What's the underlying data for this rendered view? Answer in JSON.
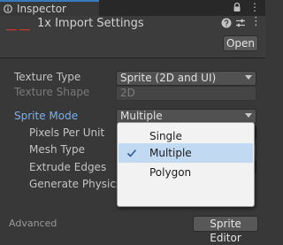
{
  "tab": {
    "title": "Inspector",
    "icon": "info-icon",
    "lock_icon": "lock-icon",
    "menu_icon": "vertical-dots-icon"
  },
  "header": {
    "title": "1x Import Settings",
    "asset_icon": "texture-asset-icon",
    "help_icon": "help-icon",
    "preset_icon": "sliders-icon",
    "more_icon": "vertical-dots-icon",
    "open_button": "Open"
  },
  "properties": {
    "texture_type": {
      "label": "Texture Type",
      "value": "Sprite (2D and UI)"
    },
    "texture_shape": {
      "label": "Texture Shape",
      "value": "2D"
    },
    "sprite_mode": {
      "label": "Sprite Mode",
      "value": "Multiple"
    },
    "pixels_per_unit": {
      "label": "Pixels Per Unit"
    },
    "mesh_type": {
      "label": "Mesh Type"
    },
    "extrude_edges": {
      "label": "Extrude Edges"
    },
    "generate_physics": {
      "label": "Generate Physics"
    }
  },
  "popup": {
    "items": [
      {
        "label": "Single",
        "selected": false
      },
      {
        "label": "Multiple",
        "selected": true
      },
      {
        "label": "Polygon",
        "selected": false
      }
    ]
  },
  "buttons": {
    "sprite_editor": "Sprite Editor"
  },
  "footer": {
    "advanced": "Advanced"
  },
  "colors": {
    "background": "#383838",
    "accent_blue": "#7bb0ee",
    "selection": "#c2daf1",
    "tab_highlight": "#3a79bb"
  }
}
